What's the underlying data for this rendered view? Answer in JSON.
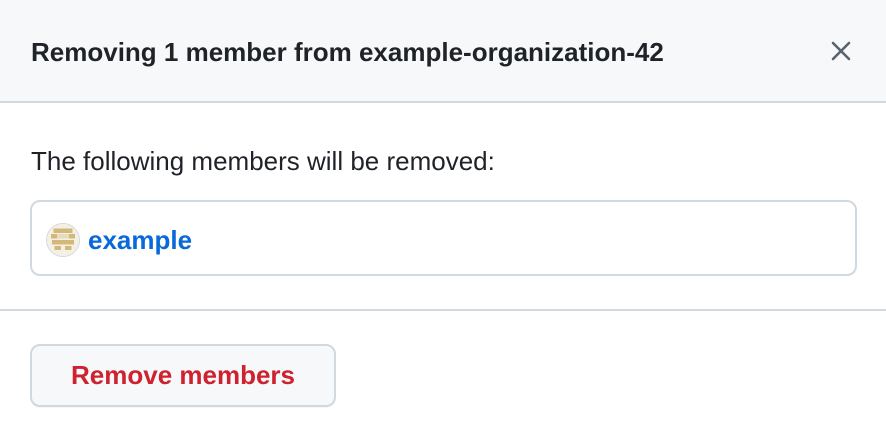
{
  "dialog": {
    "title": "Removing 1 member from example-organization-42",
    "close_icon": "close-icon",
    "body_text": "The following members will be removed:",
    "members": [
      {
        "username": "example",
        "avatar_icon": "identicon-avatar"
      }
    ],
    "remove_button_label": "Remove members"
  },
  "colors": {
    "header_bg": "#f6f8fa",
    "border": "#d1d9e0",
    "link": "#0969da",
    "danger": "#cf222e",
    "text": "#1f2328",
    "avatar_tan": "#d4b87a"
  }
}
